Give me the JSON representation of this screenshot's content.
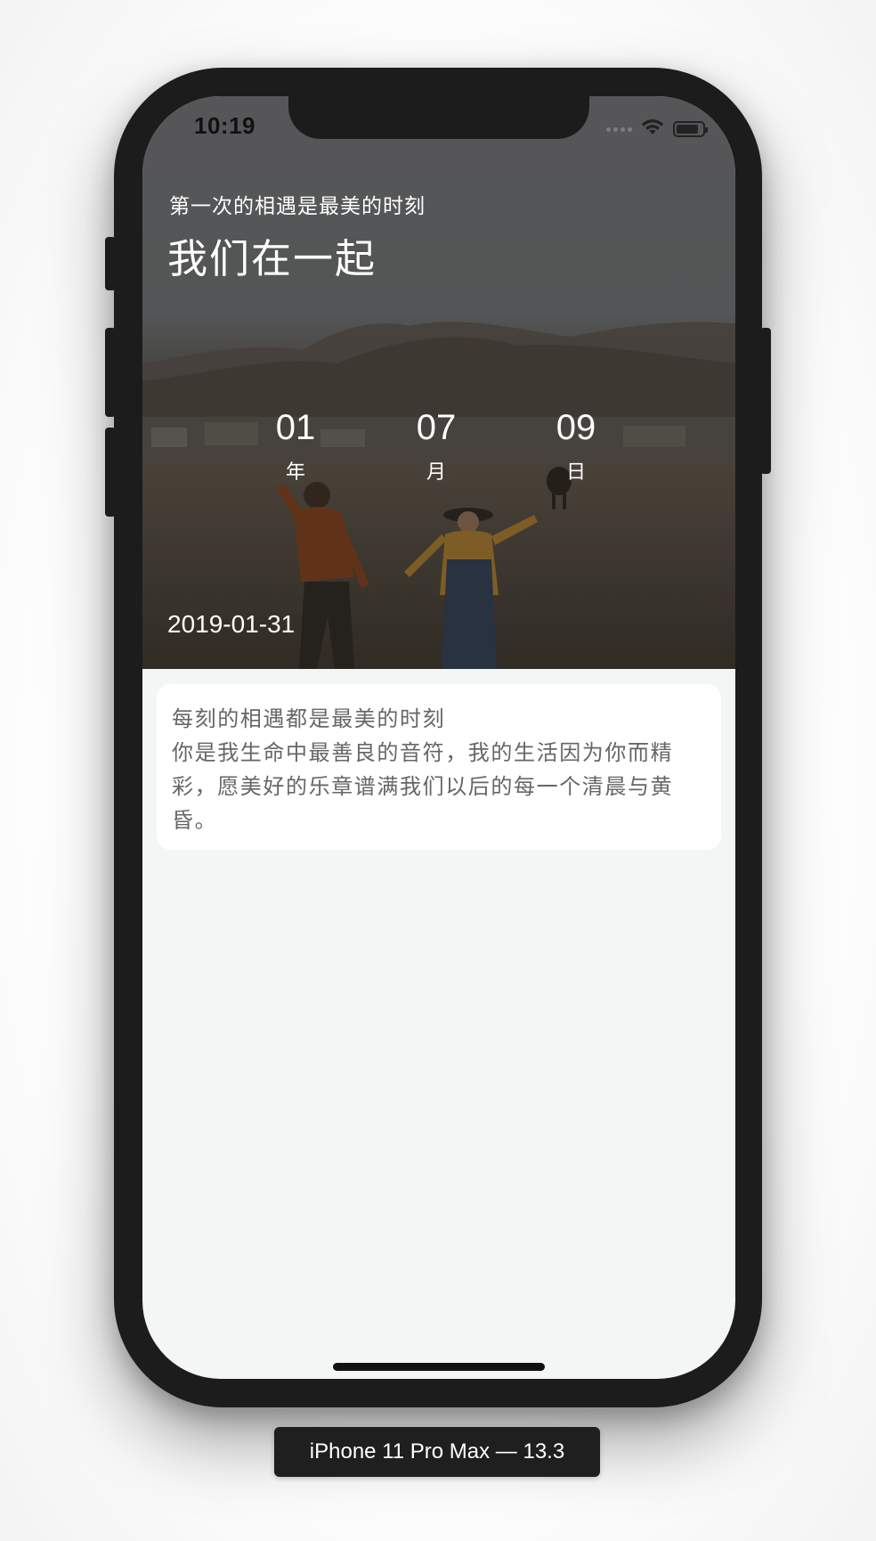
{
  "status_bar": {
    "time": "10:19",
    "icons": [
      "signal-dots-icon",
      "wifi-icon",
      "battery-icon"
    ]
  },
  "hero": {
    "subtitle": "第一次的相遇是最美的时刻",
    "title": "我们在一起",
    "counter": [
      {
        "value": "01",
        "unit": "年"
      },
      {
        "value": "07",
        "unit": "月"
      },
      {
        "value": "09",
        "unit": "日"
      }
    ],
    "date": "2019-01-31"
  },
  "card": {
    "lines": [
      "每刻的相遇都是最美的时刻",
      "你是我生命中最善良的音符，我的生活因为你而精",
      "彩，愿美好的乐章谱满我们以后的每一个清晨与黄",
      "昏。"
    ]
  },
  "device_label": "iPhone 11 Pro Max — 13.3",
  "colors": {
    "screen_background": "#f4f6f5",
    "card_background": "#ffffff",
    "card_text": "#666666",
    "hero_text": "#ffffff",
    "frame": "#1c1c1c"
  }
}
